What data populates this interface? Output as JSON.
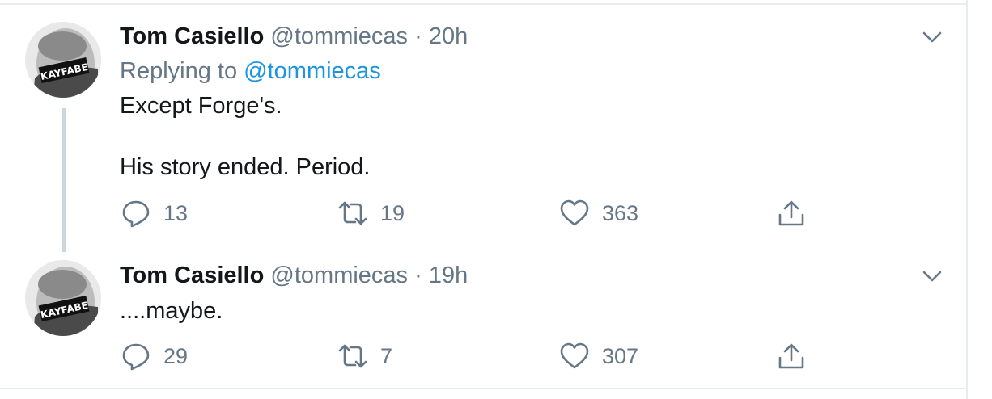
{
  "tweets": [
    {
      "name": "Tom Casiello",
      "handle": "@tommiecas",
      "separator": "·",
      "time": "20h",
      "reply_prefix": "Replying to",
      "reply_to": "@tommiecas",
      "text_line1": "Except Forge's.",
      "text_line2": "His story ended. Period.",
      "avatar_text": "KAYFABE",
      "reply_count": "13",
      "retweet_count": "19",
      "like_count": "363"
    },
    {
      "name": "Tom Casiello",
      "handle": "@tommiecas",
      "separator": "·",
      "time": "19h",
      "text_line1": "....maybe.",
      "avatar_text": "KAYFABE",
      "reply_count": "29",
      "retweet_count": "7",
      "like_count": "307"
    }
  ],
  "icons": {
    "reply": "reply-icon",
    "retweet": "retweet-icon",
    "like": "heart-icon",
    "share": "share-icon",
    "more": "chevron-down-icon"
  },
  "colors": {
    "text": "#14171a",
    "secondary": "#657786",
    "link": "#1b95e0",
    "border": "#e6ecf0",
    "thread": "#ccd6dd"
  }
}
